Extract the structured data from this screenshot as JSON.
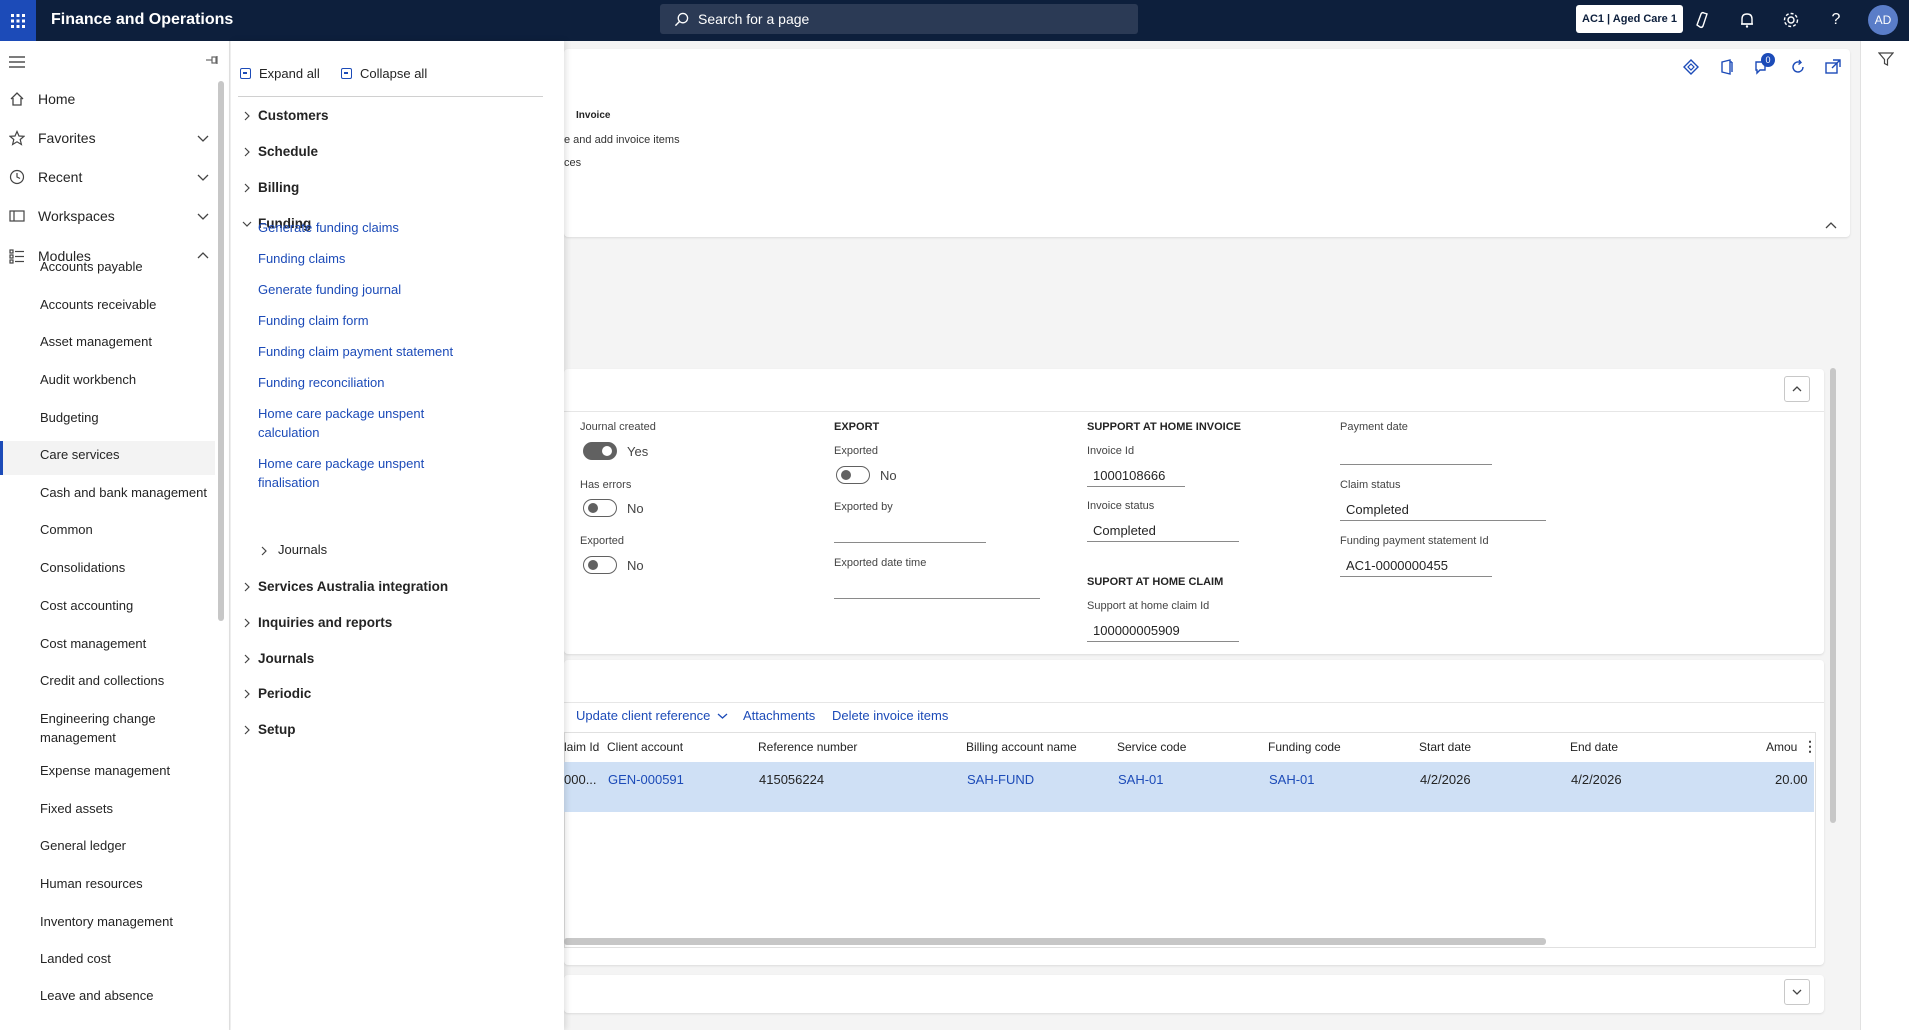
{
  "topbar": {
    "app_title": "Finance and Operations",
    "search_placeholder": "Search for a page",
    "company": "AC1 | Aged Care 1",
    "avatar": "AD"
  },
  "nav": {
    "items": [
      {
        "label": "Home",
        "icon": "home-icon"
      },
      {
        "label": "Favorites",
        "icon": "star-icon"
      },
      {
        "label": "Recent",
        "icon": "clock-icon"
      },
      {
        "label": "Workspaces",
        "icon": "workspaces-icon"
      },
      {
        "label": "Modules",
        "icon": "list-icon"
      }
    ],
    "modules": [
      "Accounts payable",
      "Accounts receivable",
      "Asset management",
      "Audit workbench",
      "Budgeting",
      "Care services",
      "Cash and bank management",
      "Common",
      "Consolidations",
      "Cost accounting",
      "Cost management",
      "Credit and collections",
      "Engineering change management",
      "Expense management",
      "Fixed assets",
      "General ledger",
      "Human resources",
      "Inventory management",
      "Landed cost",
      "Leave and absence"
    ],
    "active_module": "Care services"
  },
  "flyout": {
    "expand_all": "Expand all",
    "collapse_all": "Collapse all",
    "groups": {
      "customers": "Customers",
      "schedule": "Schedule",
      "billing": "Billing",
      "funding": "Funding",
      "services_australia": "Services Australia integration",
      "inquiries": "Inquiries and reports",
      "journals": "Journals",
      "periodic": "Periodic",
      "setup": "Setup"
    },
    "funding_links": [
      "Generate funding claims",
      "Funding claims",
      "Generate funding journal",
      "Funding claim form",
      "Funding claim payment statement",
      "Funding reconciliation",
      "Home care package unspent calculation",
      "Home care package unspent finalisation"
    ],
    "funding_sub_journals": "Journals"
  },
  "main": {
    "top_fragment": {
      "heading": "Invoice",
      "line1": "e and add invoice items",
      "line2": "ces"
    },
    "notifications_badge": "0",
    "fields": {
      "journal_created_label": "Journal created",
      "journal_created_value": "Yes",
      "has_errors_label": "Has errors",
      "has_errors_value": "No",
      "exported_label": "Exported",
      "exported_value": "No",
      "export_heading": "EXPORT",
      "export_exported_label": "Exported",
      "export_exported_value": "No",
      "exported_by_label": "Exported by",
      "exported_by_value": "",
      "exported_dt_label": "Exported date time",
      "exported_dt_value": "",
      "sah_invoice_heading": "SUPPORT AT HOME INVOICE",
      "invoice_id_label": "Invoice Id",
      "invoice_id_value": "1000108666",
      "invoice_status_label": "Invoice status",
      "invoice_status_value": "Completed",
      "sah_claim_heading": "SUPORT AT HOME CLAIM",
      "sah_claim_id_label": "Support at home claim Id",
      "sah_claim_id_value": "100000005909",
      "payment_date_label": "Payment date",
      "payment_date_value": "",
      "claim_status_label": "Claim status",
      "claim_status_value": "Completed",
      "fps_id_label": "Funding payment statement Id",
      "fps_id_value": "AC1-0000000455"
    },
    "actions": {
      "update_client_reference": "Update client reference",
      "attachments": "Attachments",
      "delete_invoice_items": "Delete invoice items"
    },
    "grid": {
      "headers": {
        "claim_id": "laim Id",
        "client_account": "Client account",
        "reference_number": "Reference number",
        "billing_account_name": "Billing account name",
        "service_code": "Service code",
        "funding_code": "Funding code",
        "start_date": "Start date",
        "end_date": "End date",
        "amount": "Amou"
      },
      "row": {
        "claim_id": "000...",
        "client_account": "GEN-000591",
        "reference_number": "415056224",
        "billing_account_name": "SAH-FUND",
        "service_code": "SAH-01",
        "funding_code": "SAH-01",
        "start_date": "4/2/2026",
        "end_date": "4/2/2026",
        "amount": "20.00"
      }
    }
  },
  "colors": {
    "topbar": "#0d1f3c",
    "accent": "#1c4bb8",
    "selected_row": "#cfe0f5"
  }
}
